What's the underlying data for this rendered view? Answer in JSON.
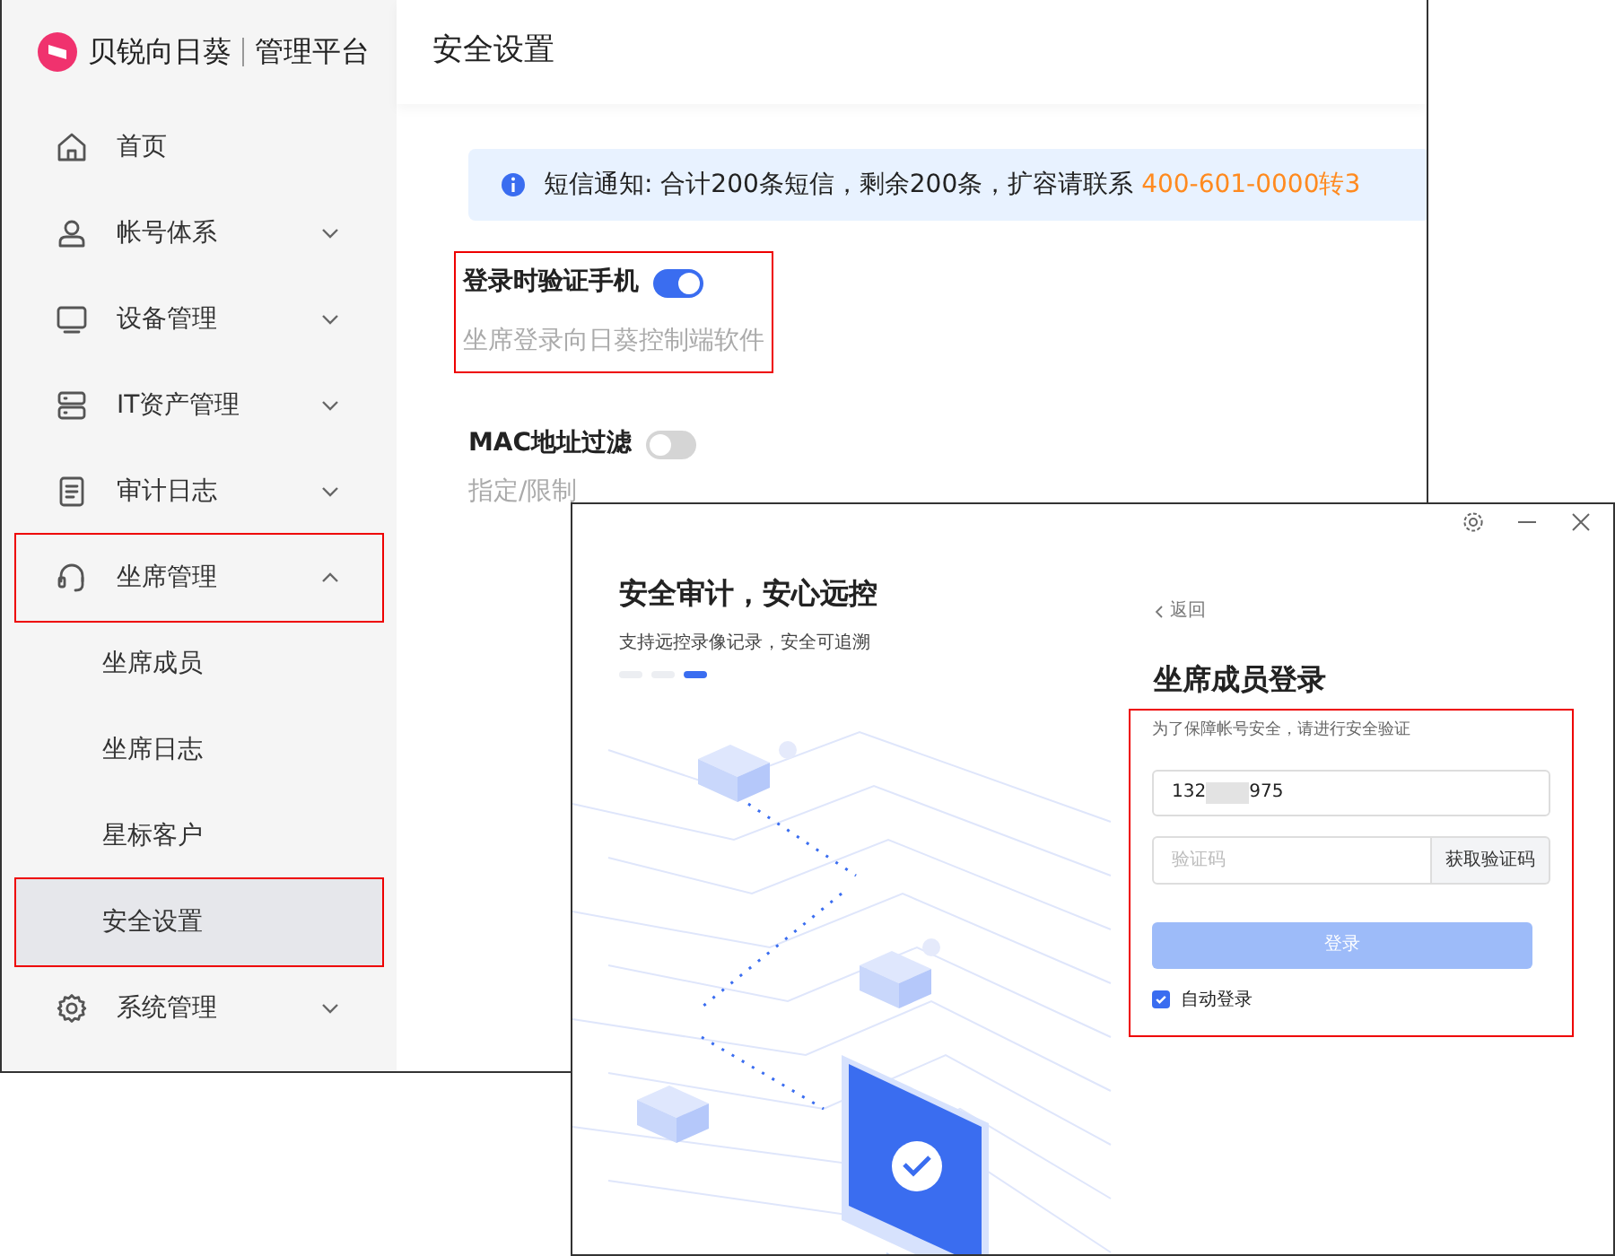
{
  "back_window": {
    "logo": {
      "brand": "贝锐向日葵",
      "product": "管理平台"
    },
    "page_title": "安全设置",
    "sidebar": {
      "items": [
        {
          "label": "首页",
          "kind": "link"
        },
        {
          "label": "帐号体系",
          "kind": "group",
          "expanded": false,
          "annotated": false
        },
        {
          "label": "设备管理",
          "kind": "group",
          "expanded": false,
          "annotated": false
        },
        {
          "label": "IT资产管理",
          "kind": "group",
          "expanded": false,
          "annotated": false
        },
        {
          "label": "审计日志",
          "kind": "group",
          "expanded": false,
          "annotated": false
        },
        {
          "label": "坐席管理",
          "kind": "group",
          "expanded": true,
          "annotated": true,
          "children": [
            {
              "label": "坐席成员",
              "selected": false,
              "annotated": false
            },
            {
              "label": "坐席日志",
              "selected": false,
              "annotated": false
            },
            {
              "label": "星标客户",
              "selected": false,
              "annotated": false
            },
            {
              "label": "安全设置",
              "selected": true,
              "annotated": true
            }
          ]
        },
        {
          "label": "系统管理",
          "kind": "group",
          "expanded": false,
          "annotated": false
        }
      ]
    },
    "notice": {
      "text": "短信通知: 合计200条短信，剩余200条，扩容请联系 ",
      "contact": "400-601-0000转3"
    },
    "settings": [
      {
        "label": "登录时验证手机",
        "on": true,
        "annotated": true,
        "description": "坐席登录向日葵控制端软件"
      },
      {
        "label": "MAC地址过滤",
        "on": false,
        "description": "指定/限制"
      }
    ]
  },
  "front_window": {
    "headline": "安全审计，安心远控",
    "tagline": "支持远控录像记录，安全可追溯",
    "slides": [
      {
        "selected": false
      },
      {
        "selected": false
      },
      {
        "selected": true
      }
    ],
    "back_link": "返回",
    "form_title": "坐席成员登录",
    "form": {
      "annotated": true,
      "hint": "为了保障帐号安全，请进行安全验证",
      "phone": {
        "value_start": "132",
        "value_end": "975"
      },
      "code": {
        "placeholder": "验证码",
        "button": "获取验证码"
      },
      "submit": {
        "label": "登录",
        "disabled": true
      },
      "auto_login": {
        "label": "自动登录",
        "checked": true
      }
    }
  }
}
